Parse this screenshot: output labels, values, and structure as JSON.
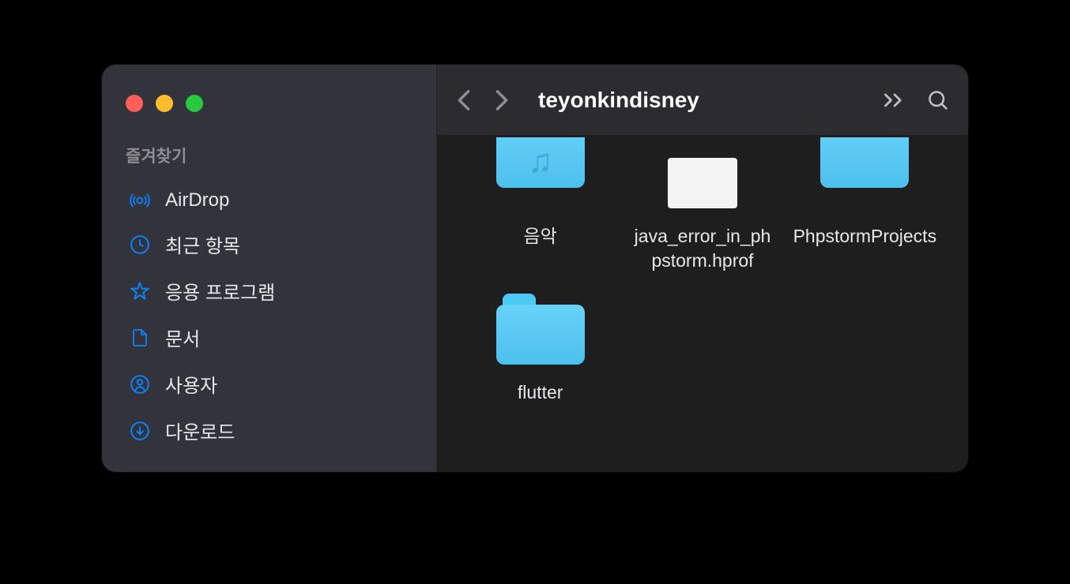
{
  "sidebar": {
    "section_title": "즐겨찾기",
    "items": [
      {
        "label": "AirDrop",
        "icon": "airdrop"
      },
      {
        "label": "최근 항목",
        "icon": "clock"
      },
      {
        "label": "응용 프로그램",
        "icon": "apps"
      },
      {
        "label": "문서",
        "icon": "document"
      },
      {
        "label": "사용자",
        "icon": "user"
      },
      {
        "label": "다운로드",
        "icon": "download"
      }
    ]
  },
  "toolbar": {
    "title": "teyonkindisney"
  },
  "content": {
    "items": [
      {
        "label": "음악",
        "type": "folder-music",
        "cut": true
      },
      {
        "label": "java_error_in_phpstorm.hprof",
        "type": "file"
      },
      {
        "label": "PhpstormProjects",
        "type": "folder",
        "cut": true
      },
      {
        "label": "flutter",
        "type": "folder"
      }
    ]
  }
}
